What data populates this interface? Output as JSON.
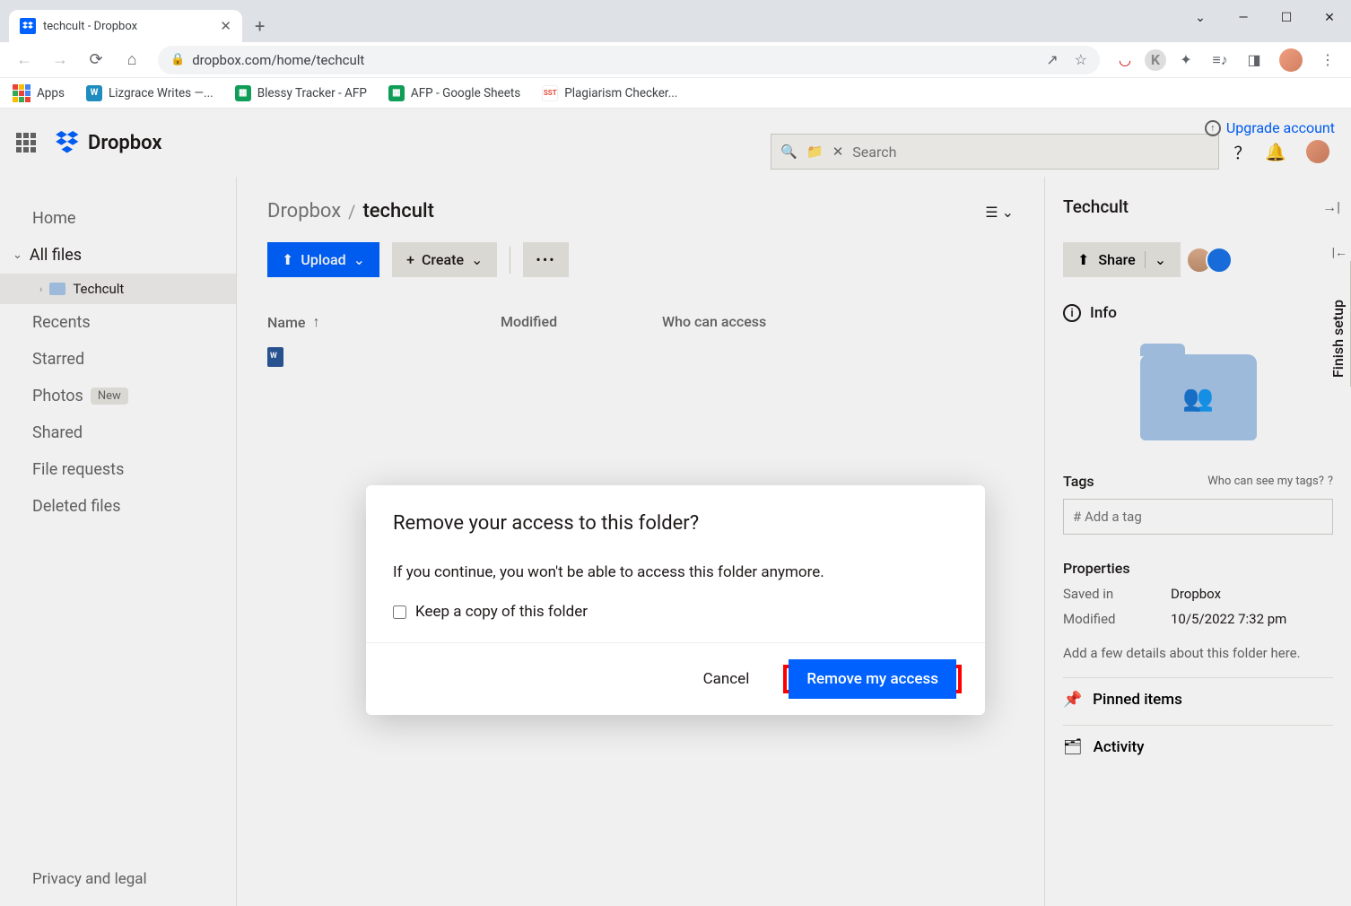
{
  "browser": {
    "tab_title": "techcult - Dropbox",
    "url": "dropbox.com/home/techcult",
    "bookmarks": [
      {
        "label": "Apps"
      },
      {
        "label": "Lizgrace Writes —..."
      },
      {
        "label": "Blessy Tracker - AFP"
      },
      {
        "label": "AFP - Google Sheets"
      },
      {
        "label": "Plagiarism Checker..."
      }
    ]
  },
  "header": {
    "logo_text": "Dropbox",
    "upgrade": "Upgrade account",
    "search_placeholder": "Search"
  },
  "sidebar": {
    "items": [
      {
        "label": "Home"
      },
      {
        "label": "All files"
      },
      {
        "label": "Recents"
      },
      {
        "label": "Starred"
      },
      {
        "label": "Photos",
        "badge": "New"
      },
      {
        "label": "Shared"
      },
      {
        "label": "File requests"
      },
      {
        "label": "Deleted files"
      }
    ],
    "subfolder": "Techcult",
    "footer": "Privacy and legal"
  },
  "main": {
    "breadcrumb_root": "Dropbox",
    "breadcrumb_current": "techcult",
    "upload": "Upload",
    "create": "Create",
    "columns": {
      "name": "Name",
      "modified": "Modified",
      "access": "Who can access"
    }
  },
  "rightpanel": {
    "title": "Techcult",
    "share": "Share",
    "info": "Info",
    "tags": "Tags",
    "tags_link": "Who can see my tags?",
    "tag_placeholder": "# Add a tag",
    "properties": "Properties",
    "props": [
      {
        "k": "Saved in",
        "v": "Dropbox"
      },
      {
        "k": "Modified",
        "v": "10/5/2022 7:32 pm"
      }
    ],
    "hint": "Add a few details about this folder here.",
    "pinned": "Pinned items",
    "activity": "Activity"
  },
  "finish_setup": "Finish setup",
  "modal": {
    "title": "Remove your access to this folder?",
    "body": "If you continue, you won't be able to access this folder anymore.",
    "checkbox": "Keep a copy of this folder",
    "cancel": "Cancel",
    "confirm": "Remove my access"
  }
}
